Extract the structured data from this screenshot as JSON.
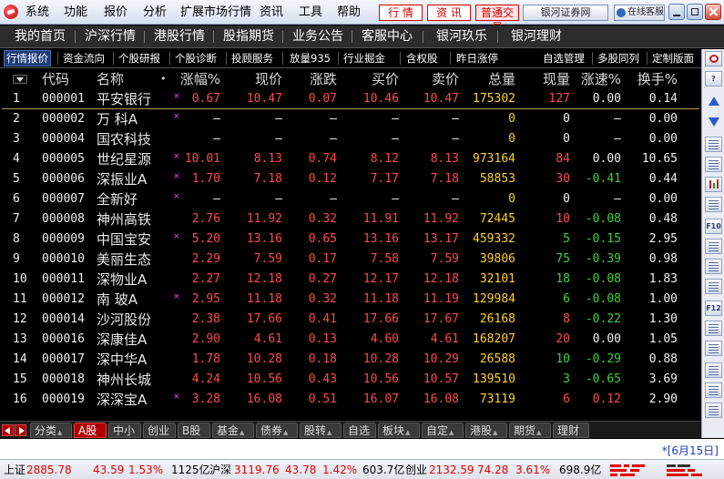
{
  "menubar": {
    "items": [
      "系统",
      "功能",
      "报价",
      "分析",
      "扩展市场行情",
      "资讯",
      "工具",
      "帮助"
    ],
    "quote_btn": "行 情",
    "info_btn": "资 讯",
    "normal_trade_btn": "普通交易",
    "broker_btn": "银河证券网",
    "online_btn": "在线客服"
  },
  "navbar": {
    "items": [
      "我的首页",
      "沪深行情",
      "港股行情",
      "股指期货",
      "业务公告",
      "客服中心",
      "银河玖乐",
      "银河理财"
    ]
  },
  "functabs": {
    "items": [
      "行情报价",
      "资金流向",
      "个股研报",
      "个股诊断",
      "投顾服务",
      "放量935",
      "行业掘金",
      "含权股",
      "昨日涨停"
    ],
    "right_items": [
      "自选管理",
      "多股同列",
      "定制版面"
    ]
  },
  "table": {
    "headers": [
      "代码",
      "名称",
      "•",
      "涨幅%",
      "现价",
      "涨跌",
      "买价",
      "卖价",
      "总量",
      "现量",
      "涨速%",
      "换手%"
    ],
    "rows": [
      {
        "idx": "1",
        "code": "000001",
        "name": "平安银行",
        "mark": "×",
        "pct": "0.67",
        "price": "10.47",
        "chg": "0.07",
        "bid": "10.46",
        "ask": "10.47",
        "vol": "175302",
        "cur": "127",
        "speed": "0.00",
        "turn": "0.14",
        "dir": "up",
        "cur_dir": "up",
        "speed_dir": "flat"
      },
      {
        "idx": "2",
        "code": "000002",
        "name": "万 科A",
        "mark": "×",
        "pct": "–",
        "price": "–",
        "chg": "–",
        "bid": "–",
        "ask": "–",
        "vol": "0",
        "cur": "0",
        "speed": "–",
        "turn": "0.00",
        "dir": "flat",
        "cur_dir": "flat",
        "speed_dir": "flat"
      },
      {
        "idx": "3",
        "code": "000004",
        "name": "国农科技",
        "mark": "",
        "pct": "–",
        "price": "–",
        "chg": "–",
        "bid": "–",
        "ask": "–",
        "vol": "0",
        "cur": "0",
        "speed": "–",
        "turn": "0.00",
        "dir": "flat",
        "cur_dir": "flat",
        "speed_dir": "flat"
      },
      {
        "idx": "4",
        "code": "000005",
        "name": "世纪星源",
        "mark": "×",
        "pct": "10.01",
        "price": "8.13",
        "chg": "0.74",
        "bid": "8.12",
        "ask": "8.13",
        "vol": "973164",
        "cur": "84",
        "speed": "0.00",
        "turn": "10.65",
        "dir": "up",
        "cur_dir": "up",
        "speed_dir": "flat"
      },
      {
        "idx": "5",
        "code": "000006",
        "name": "深振业A",
        "mark": "×",
        "pct": "1.70",
        "price": "7.18",
        "chg": "0.12",
        "bid": "7.17",
        "ask": "7.18",
        "vol": "58853",
        "cur": "30",
        "speed": "-0.41",
        "turn": "0.44",
        "dir": "up",
        "cur_dir": "up",
        "speed_dir": "down"
      },
      {
        "idx": "6",
        "code": "000007",
        "name": "全新好",
        "mark": "×",
        "pct": "–",
        "price": "–",
        "chg": "–",
        "bid": "–",
        "ask": "–",
        "vol": "0",
        "cur": "0",
        "speed": "–",
        "turn": "0.00",
        "dir": "flat",
        "cur_dir": "flat",
        "speed_dir": "flat"
      },
      {
        "idx": "7",
        "code": "000008",
        "name": "神州高铁",
        "mark": "",
        "pct": "2.76",
        "price": "11.92",
        "chg": "0.32",
        "bid": "11.91",
        "ask": "11.92",
        "vol": "72445",
        "cur": "10",
        "speed": "-0.08",
        "turn": "0.48",
        "dir": "up",
        "cur_dir": "up",
        "speed_dir": "down"
      },
      {
        "idx": "8",
        "code": "000009",
        "name": "中国宝安",
        "mark": "×",
        "pct": "5.20",
        "price": "13.16",
        "chg": "0.65",
        "bid": "13.16",
        "ask": "13.17",
        "vol": "459332",
        "cur": "5",
        "speed": "-0.15",
        "turn": "2.95",
        "dir": "up",
        "cur_dir": "down",
        "speed_dir": "down"
      },
      {
        "idx": "9",
        "code": "000010",
        "name": "美丽生态",
        "mark": "",
        "pct": "2.29",
        "price": "7.59",
        "chg": "0.17",
        "bid": "7.58",
        "ask": "7.59",
        "vol": "39806",
        "cur": "75",
        "speed": "-0.39",
        "turn": "0.98",
        "dir": "up",
        "cur_dir": "down",
        "speed_dir": "down"
      },
      {
        "idx": "10",
        "code": "000011",
        "name": "深物业A",
        "mark": "",
        "pct": "2.27",
        "price": "12.18",
        "chg": "0.27",
        "bid": "12.17",
        "ask": "12.18",
        "vol": "32101",
        "cur": "18",
        "speed": "-0.08",
        "turn": "1.83",
        "dir": "up",
        "cur_dir": "down",
        "speed_dir": "down"
      },
      {
        "idx": "11",
        "code": "000012",
        "name": "南 玻A",
        "mark": "×",
        "pct": "2.95",
        "price": "11.18",
        "chg": "0.32",
        "bid": "11.18",
        "ask": "11.19",
        "vol": "129984",
        "cur": "6",
        "speed": "-0.08",
        "turn": "1.00",
        "dir": "up",
        "cur_dir": "down",
        "speed_dir": "down"
      },
      {
        "idx": "12",
        "code": "000014",
        "name": "沙河股份",
        "mark": "",
        "pct": "2.38",
        "price": "17.66",
        "chg": "0.41",
        "bid": "17.66",
        "ask": "17.67",
        "vol": "26168",
        "cur": "8",
        "speed": "-0.22",
        "turn": "1.30",
        "dir": "up",
        "cur_dir": "up",
        "speed_dir": "down"
      },
      {
        "idx": "13",
        "code": "000016",
        "name": "深康佳A",
        "mark": "",
        "pct": "2.90",
        "price": "4.61",
        "chg": "0.13",
        "bid": "4.60",
        "ask": "4.61",
        "vol": "168207",
        "cur": "20",
        "speed": "0.00",
        "turn": "1.05",
        "dir": "up",
        "cur_dir": "up",
        "speed_dir": "flat"
      },
      {
        "idx": "14",
        "code": "000017",
        "name": "深中华A",
        "mark": "",
        "pct": "1.78",
        "price": "10.28",
        "chg": "0.18",
        "bid": "10.28",
        "ask": "10.29",
        "vol": "26588",
        "cur": "10",
        "speed": "-0.29",
        "turn": "0.88",
        "dir": "up",
        "cur_dir": "down",
        "speed_dir": "down"
      },
      {
        "idx": "15",
        "code": "000018",
        "name": "神州长城",
        "mark": "",
        "pct": "4.24",
        "price": "10.56",
        "chg": "0.43",
        "bid": "10.56",
        "ask": "10.57",
        "vol": "139510",
        "cur": "3",
        "speed": "-0.65",
        "turn": "3.69",
        "dir": "up",
        "cur_dir": "down",
        "speed_dir": "down"
      },
      {
        "idx": "16",
        "code": "000019",
        "name": "深深宝A",
        "mark": "×",
        "pct": "3.28",
        "price": "16.08",
        "chg": "0.51",
        "bid": "16.07",
        "ask": "16.08",
        "vol": "73119",
        "cur": "6",
        "speed": "0.12",
        "turn": "2.90",
        "dir": "up",
        "cur_dir": "up",
        "speed_dir": "up"
      }
    ]
  },
  "right_toolbar": {
    "icons": [
      "exit-icon",
      "help-icon",
      "up-arrow-icon",
      "down-arrow-icon",
      "quote-list-icon",
      "minute-chart-icon",
      "kline-chart-icon",
      "report-icon",
      "f10-icon",
      "depth-icon",
      "sort-icon",
      "detail-icon",
      "f12-icon",
      "history-icon",
      "indicator-icon",
      "formula-icon",
      "trend-icon",
      "split-icon",
      "alert-icon",
      "custom-icon"
    ],
    "texts": [
      "",
      "?",
      "",
      "",
      "",
      "",
      "",
      "",
      "F10",
      "",
      "",
      "",
      "F12",
      "",
      "",
      "",
      "",
      "",
      "",
      ""
    ]
  },
  "bottom_tabs": {
    "items": [
      {
        "label": "分类",
        "arrow": true
      },
      {
        "label": "A股",
        "arrow": false,
        "active": true
      },
      {
        "label": "中小",
        "arrow": false
      },
      {
        "label": "创业",
        "arrow": false
      },
      {
        "label": "B股",
        "arrow": false
      },
      {
        "label": "基金",
        "arrow": true
      },
      {
        "label": "债券",
        "arrow": true
      },
      {
        "label": "股转",
        "arrow": true
      },
      {
        "label": "自选",
        "arrow": false
      },
      {
        "label": "板块",
        "arrow": true
      },
      {
        "label": "自定",
        "arrow": true
      },
      {
        "label": "港股",
        "arrow": true
      },
      {
        "label": "期货",
        "arrow": true
      },
      {
        "label": "理财",
        "arrow": false
      }
    ]
  },
  "infobar": {
    "date_link": "*[6月15日]"
  },
  "statusbar": {
    "sh_label": "上证",
    "sh_index": "2885.78",
    "sh_chg": "43.59",
    "sh_pct": "1.53%",
    "sh_amt": "1125亿",
    "sz_label": "沪深",
    "sz_index": "3119.76",
    "sz_chg": "43.78",
    "sz_pct": "1.42%",
    "sz_amt": "603.7亿",
    "cy_label": "创业",
    "cy_index": "2132.59",
    "cy_chg": "74.28",
    "cy_pct": "3.61%",
    "cy_amt": "698.9亿"
  },
  "colors": {
    "up": "#ff4a4a",
    "down": "#3cd23c",
    "flat": "#f0f0f0",
    "volume": "#ffd21e",
    "active_tab": "#b00000"
  }
}
